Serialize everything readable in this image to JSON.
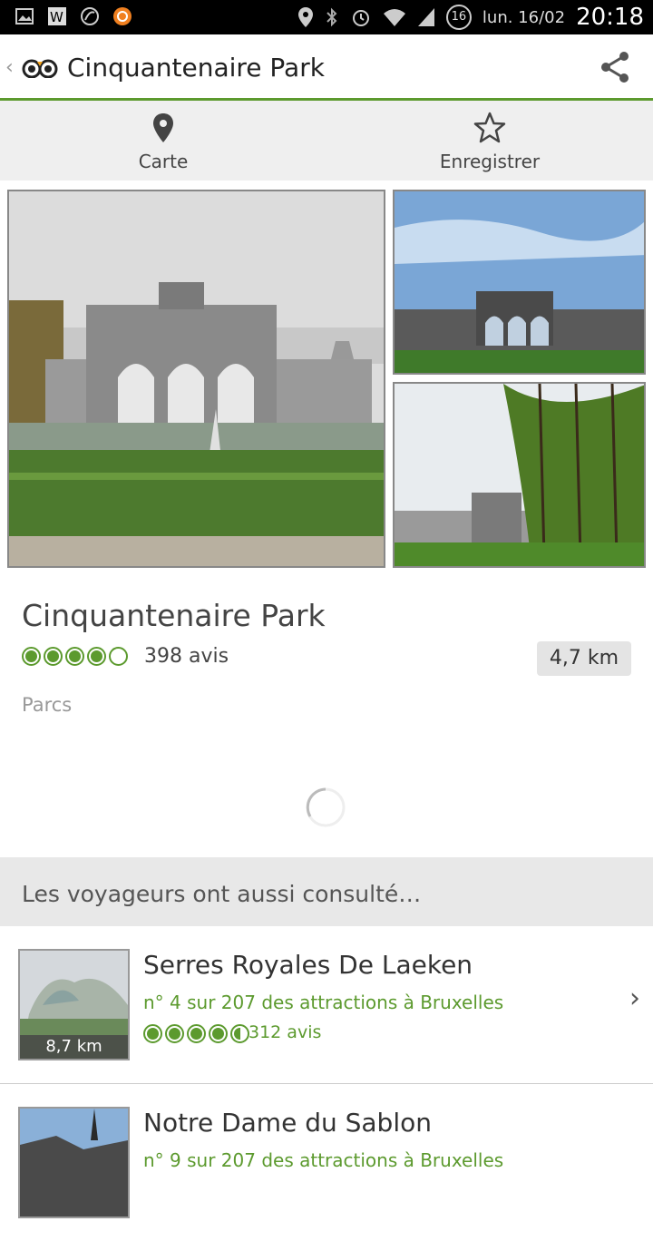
{
  "status_bar": {
    "date": "lun. 16/02",
    "time": "20:18",
    "notification_count": "16"
  },
  "header": {
    "title": "Cinquantenaire Park"
  },
  "tabs": [
    {
      "label": "Carte",
      "icon": "map-pin-icon"
    },
    {
      "label": "Enregistrer",
      "icon": "star-outline-icon"
    }
  ],
  "place": {
    "name": "Cinquantenaire Park",
    "rating": 4,
    "reviews": "398 avis",
    "distance": "4,7 km",
    "category": "Parcs"
  },
  "related": {
    "header": "Les voyageurs ont aussi consulté…",
    "items": [
      {
        "title": "Serres Royales De Laeken",
        "rank": "n° 4 sur 207 des attractions à Bruxelles",
        "rating": 4.5,
        "reviews": "312 avis",
        "distance": "8,7 km"
      },
      {
        "title": "Notre Dame du Sablon",
        "rank": "n° 9 sur 207 des attractions à Bruxelles"
      }
    ]
  },
  "colors": {
    "accent": "#5c9a2e",
    "header_bg": "#ffffff",
    "tab_bg": "#efefef"
  }
}
